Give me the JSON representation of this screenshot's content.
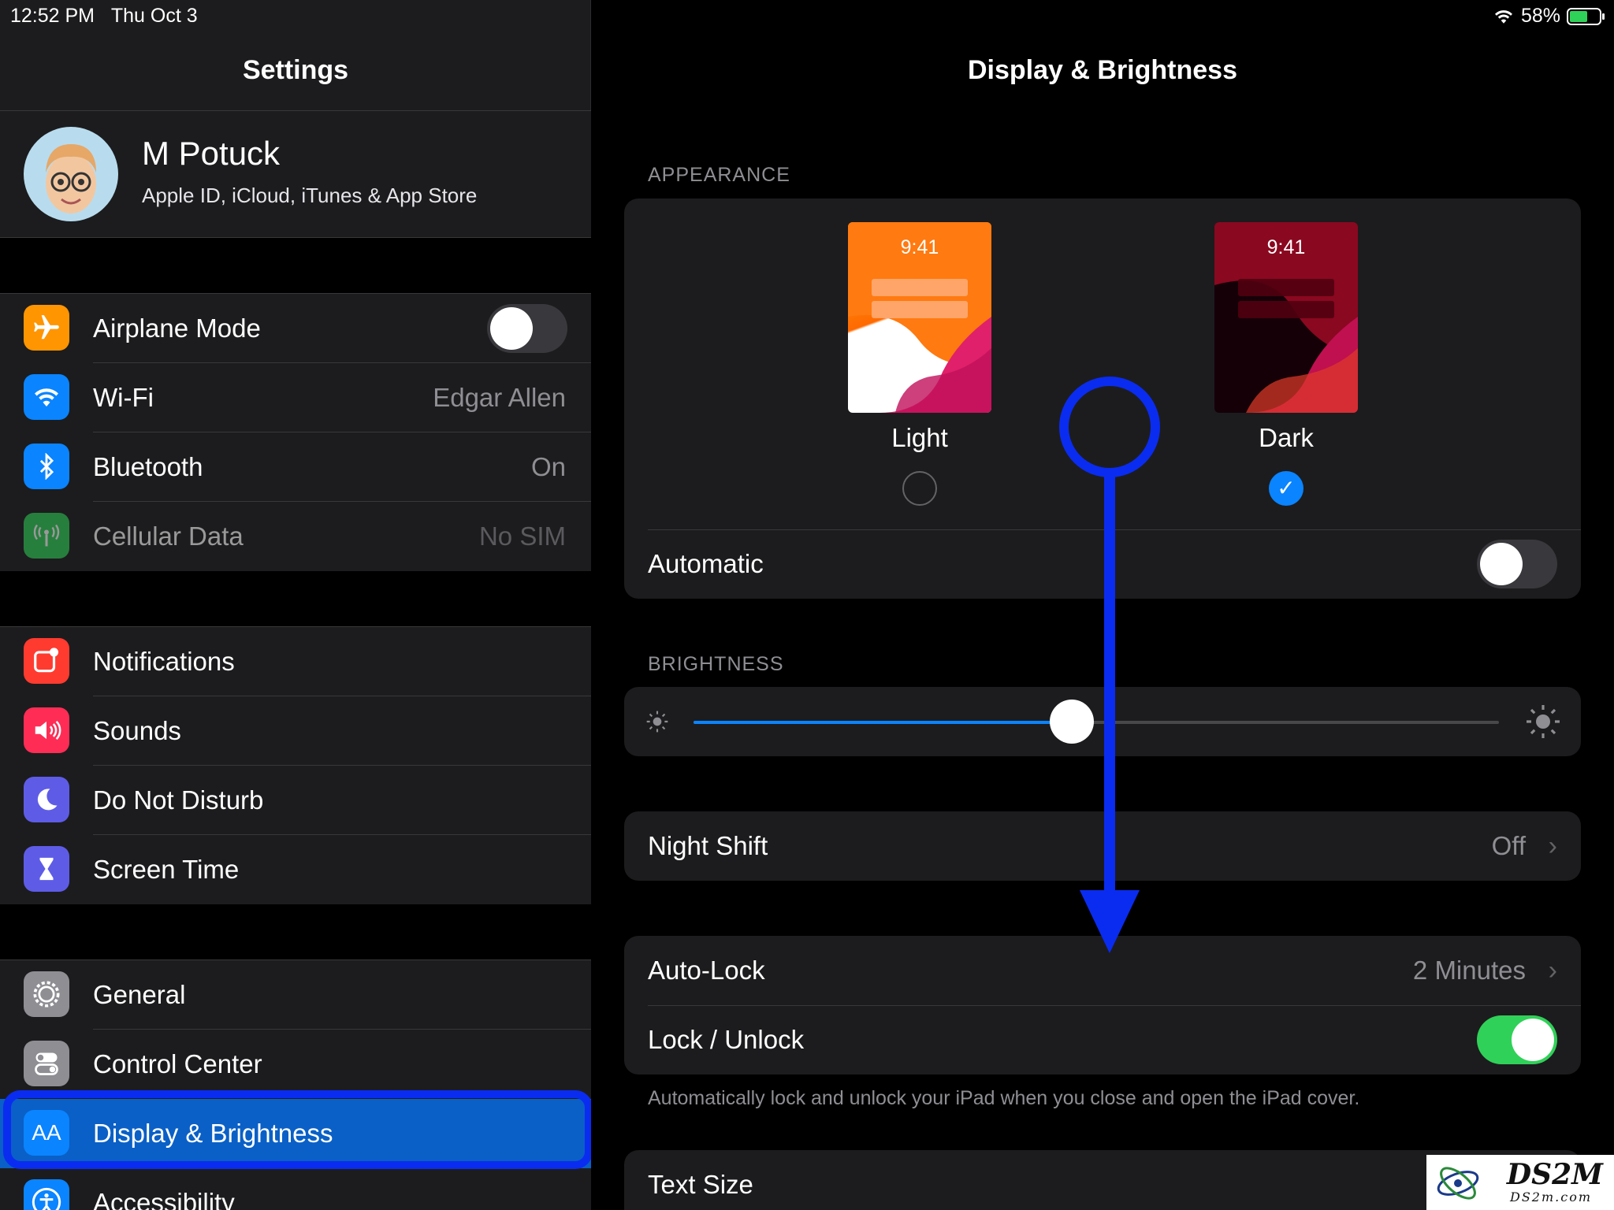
{
  "status": {
    "time": "12:52 PM",
    "date": "Thu Oct 3",
    "battery": "58%",
    "battery_level": 0.58
  },
  "sidebar": {
    "title": "Settings",
    "profile": {
      "name": "M Potuck",
      "subtitle": "Apple ID, iCloud, iTunes & App Store"
    },
    "group1": [
      {
        "label": "Airplane Mode",
        "icon": "airplane-icon",
        "color": "#ff9500",
        "toggle": false
      },
      {
        "label": "Wi-Fi",
        "value": "Edgar Allen",
        "icon": "wifi-icon",
        "color": "#0a84ff"
      },
      {
        "label": "Bluetooth",
        "value": "On",
        "icon": "bluetooth-icon",
        "color": "#0a84ff"
      },
      {
        "label": "Cellular Data",
        "value": "No SIM",
        "icon": "antenna-icon",
        "color": "#30d158"
      }
    ],
    "group2": [
      {
        "label": "Notifications",
        "icon": "notifications-icon",
        "color": "#ff3b30"
      },
      {
        "label": "Sounds",
        "icon": "speaker-icon",
        "color": "#ff2d55"
      },
      {
        "label": "Do Not Disturb",
        "icon": "moon-icon",
        "color": "#5e5ce6"
      },
      {
        "label": "Screen Time",
        "icon": "hourglass-icon",
        "color": "#5e5ce6"
      }
    ],
    "group3": [
      {
        "label": "General",
        "icon": "gear-icon",
        "color": "#8e8e93"
      },
      {
        "label": "Control Center",
        "icon": "switches-icon",
        "color": "#8e8e93"
      },
      {
        "label": "Display & Brightness",
        "icon": "text-size-icon",
        "glyph": "AA",
        "color": "#0a84ff",
        "selected": true
      },
      {
        "label": "Accessibility",
        "icon": "accessibility-icon",
        "color": "#0a84ff"
      }
    ]
  },
  "detail": {
    "title": "Display & Brightness",
    "appearance": {
      "header": "APPEARANCE",
      "light": {
        "label": "Light",
        "time": "9:41",
        "selected": false
      },
      "dark": {
        "label": "Dark",
        "time": "9:41",
        "selected": true
      },
      "automatic": {
        "label": "Automatic",
        "on": false
      }
    },
    "brightness": {
      "header": "BRIGHTNESS",
      "level": 0.47
    },
    "night_shift": {
      "label": "Night Shift",
      "value": "Off"
    },
    "auto_lock": {
      "label": "Auto-Lock",
      "value": "2 Minutes"
    },
    "lock_unlock": {
      "label": "Lock / Unlock",
      "on": true
    },
    "lock_note": "Automatically lock and unlock your iPad when you close and open the iPad cover.",
    "text_size": {
      "label": "Text Size"
    }
  },
  "colors": {
    "accent": "#0a84ff",
    "annotation": "#0a2cf0",
    "toggle_on": "#30d158"
  },
  "watermark": {
    "brand": "DS2M",
    "domain": "DS2m.com"
  }
}
